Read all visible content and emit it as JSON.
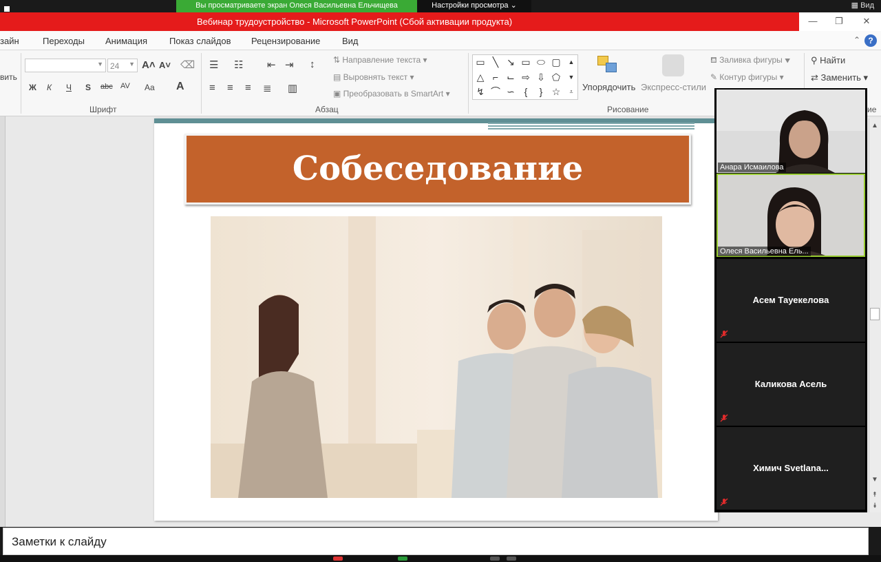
{
  "zoom": {
    "banner": "Вы просматриваете экран Олеся Васильевна Ельчищева",
    "view_settings": "Настройки просмотра ⌄",
    "view_right": "Вид"
  },
  "ppt": {
    "window_title": "Вебинар трудоустройство  -  Microsoft PowerPoint (Сбой активации продукта)",
    "tabs": [
      "зайн",
      "Переходы",
      "Анимация",
      "Показ слайдов",
      "Рецензирование",
      "Вид"
    ],
    "paste_label": "вить",
    "font_size": "24",
    "font_group_label": "Шрифт",
    "paragraph_group_label": "Абзац",
    "drawing_group_label": "Рисование",
    "editing_group_label": "ие",
    "text_direction": "Направление текста",
    "align_text": "Выровнять текст",
    "convert_smartart": "Преобразовать в SmartArt",
    "arrange": "Упорядочить",
    "quick_styles": "Экспресс-стили",
    "shape_fill": "Заливка фигуры",
    "shape_outline": "Контур фигуры",
    "find": "Найти",
    "replace": "Заменить",
    "font_buttons": [
      "Ж",
      "К",
      "Ч",
      "S",
      "abc",
      "AV",
      "Aa"
    ],
    "slide_title": "Собеседование",
    "notes_placeholder": "Заметки к слайду"
  },
  "participants": [
    {
      "name": "Анара Исмаилова",
      "video": true,
      "active": false
    },
    {
      "name": "Олеся Васильевна Ель...",
      "video": true,
      "active": true
    },
    {
      "name": "Асем Тауекелова",
      "video": false,
      "muted": true
    },
    {
      "name": "Каликова Асель",
      "video": false,
      "muted": true
    },
    {
      "name": "Химич  Svetlana...",
      "video": false,
      "muted": true
    }
  ],
  "colors": {
    "title_bar": "#e51b1b",
    "zoom_banner": "#3aaa35",
    "slide_title_bg": "#c3622b",
    "active_speaker": "#9acd32"
  }
}
